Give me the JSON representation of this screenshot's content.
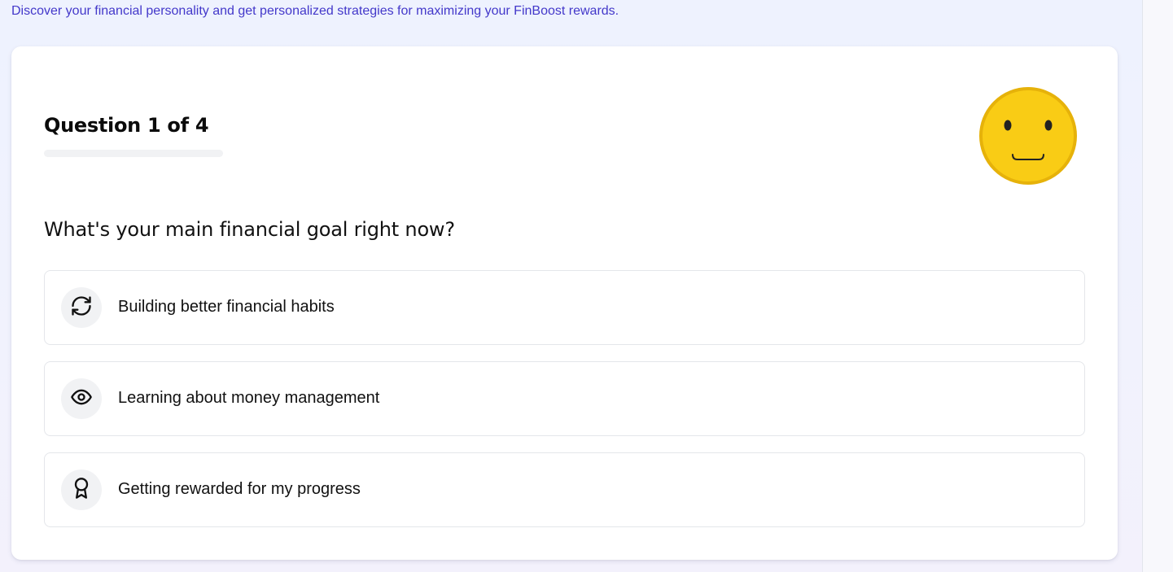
{
  "header": {
    "subtitle": "Discover your financial personality and get personalized strategies for maximizing your FinBoost rewards."
  },
  "quiz": {
    "counter": "Question 1 of 4",
    "progress_fraction": 0,
    "mascot_icon": "smiley-face-icon",
    "question": "What's your main financial goal right now?",
    "options": [
      {
        "label": "Building better financial habits",
        "icon": "refresh-cycle-icon"
      },
      {
        "label": "Learning about money management",
        "icon": "eye-icon"
      },
      {
        "label": "Getting rewarded for my progress",
        "icon": "award-ribbon-icon"
      }
    ]
  },
  "colors": {
    "accent_text": "#4338ca",
    "mascot_face": "#f9cc15",
    "mascot_outline": "#e6b20a",
    "option_border": "#e4e6ea",
    "icon_bg": "#f1f2f4"
  }
}
